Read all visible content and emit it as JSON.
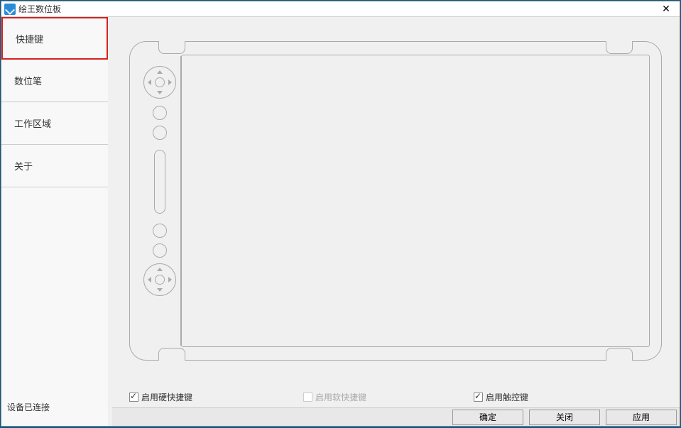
{
  "window": {
    "title": "绘王数位板"
  },
  "sidebar": {
    "items": [
      {
        "label": "快捷键"
      },
      {
        "label": "数位笔"
      },
      {
        "label": "工作区域"
      },
      {
        "label": "关于"
      }
    ]
  },
  "checkboxes": {
    "enableHardKeys": "启用硬快捷键",
    "enableSoftKeys": "启用软快捷键",
    "enableTouchKeys": "启用触控键"
  },
  "status": {
    "connected": "设备已连接"
  },
  "buttons": {
    "ok": "确定",
    "close": "关闭",
    "apply": "应用"
  }
}
